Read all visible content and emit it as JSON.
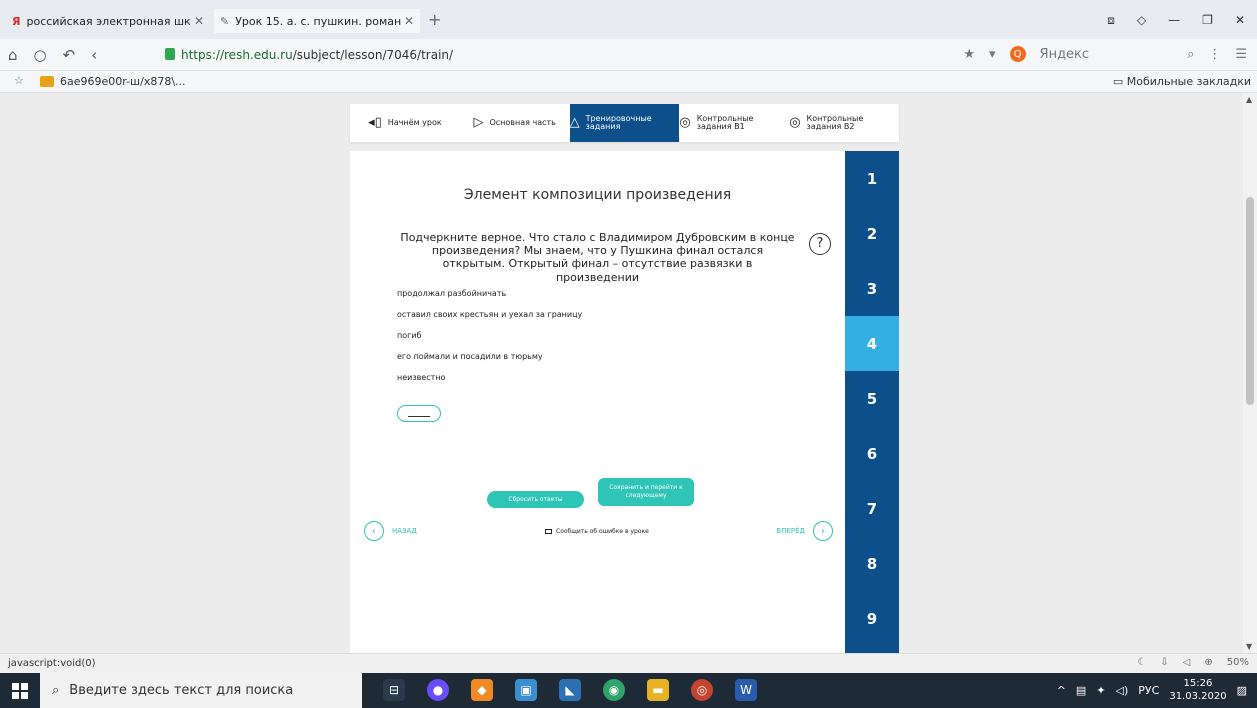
{
  "browser": {
    "tabs": [
      {
        "label": "российская электронная шк",
        "icon": "yandex-y-icon"
      },
      {
        "label": "Урок 15. а. с. пушкин. роман",
        "icon": "pencil-icon"
      }
    ],
    "url_base": "https://resh.edu.ru",
    "url_path": "/subject/lesson/7046/train/",
    "search_engine": "Яндекс",
    "bookmark": "6ae969e00r-ш/x878\\...",
    "mobile_bookmarks": "Мобильные закладки",
    "status_url": "javascript:void(0)",
    "zoom": "50%"
  },
  "lesson_nav": [
    {
      "label": "Начнём урок",
      "icon": "megaphone-icon",
      "active": false
    },
    {
      "label": "Основная часть",
      "icon": "play-icon",
      "active": false
    },
    {
      "label": "Тренировочные задания",
      "icon": "triangle-icon",
      "active": true
    },
    {
      "label": "Контрольные задания В1",
      "icon": "target-icon",
      "active": false
    },
    {
      "label": "Контрольные задания В2",
      "icon": "target-icon",
      "active": false
    }
  ],
  "task": {
    "title": "Элемент композиции произведения",
    "question": "Подчеркните верное. Что стало с Владимиром Дубровским в конце произведения? Мы знаем, что у Пушкина финал остался открытым. Открытый финал – отсутствие развязки в произведении",
    "help": "?",
    "options": [
      "продолжал разбойничать",
      "оставил своих крестьян и уехал за границу",
      "погиб",
      "его поймали и посадили в тюрьму",
      "неизвестно"
    ],
    "reset_label": "Сбросить ответы",
    "next_label": "Сохранить и перейти к следующему",
    "back_label": "НАЗАД",
    "forward_label": "ВПЕРЁД",
    "report_label": "Сообщить об ошибке в уроке"
  },
  "task_numbers": [
    "1",
    "2",
    "3",
    "4",
    "5",
    "6",
    "7",
    "8",
    "9"
  ],
  "active_task": "4",
  "taskbar": {
    "search_placeholder": "Введите здесь текст для поиска",
    "lang": "РУС",
    "time": "15:26",
    "date": "31.03.2020"
  },
  "colors": {
    "primary": "#0d4f8b",
    "accent": "#33b0e3",
    "button": "#2ec4b6"
  }
}
